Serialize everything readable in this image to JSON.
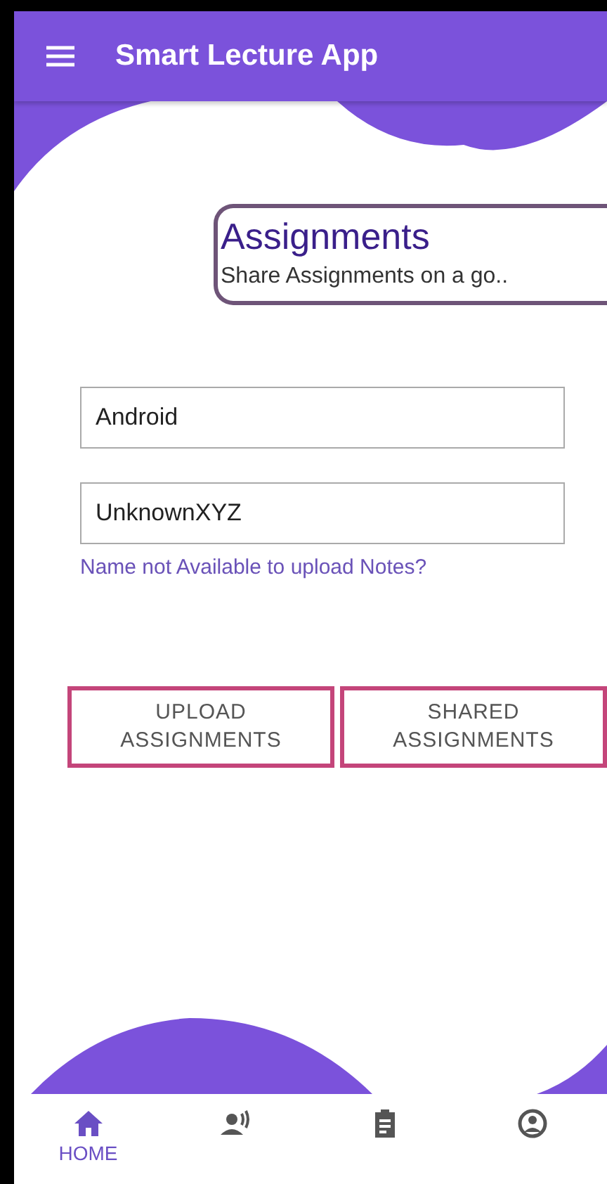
{
  "app_bar": {
    "title": "Smart Lecture App"
  },
  "header_card": {
    "title": "Assignments",
    "subtitle": "Share Assignments on a go.."
  },
  "fields": [
    {
      "value": "Android"
    },
    {
      "value": "UnknownXYZ"
    }
  ],
  "help_link": "Name not Available to upload Notes?",
  "buttons": [
    {
      "label": "UPLOAD\nASSIGNMENTS"
    },
    {
      "label": "SHARED\nASSIGNMENTS"
    }
  ],
  "bottom_nav": [
    {
      "kind": "home",
      "label": "HOME",
      "selected": true
    },
    {
      "kind": "speaker",
      "selected": false
    },
    {
      "kind": "clipboard",
      "selected": false
    },
    {
      "kind": "account",
      "selected": false
    }
  ]
}
